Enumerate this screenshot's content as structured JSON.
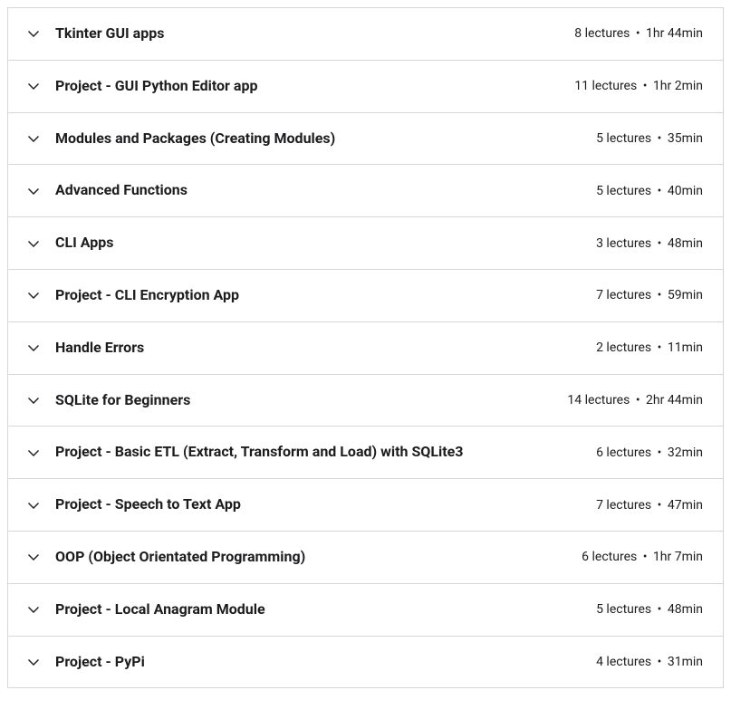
{
  "sections": [
    {
      "title": "Tkinter GUI apps",
      "lectures": "8 lectures",
      "duration": "1hr 44min"
    },
    {
      "title": "Project - GUI Python Editor app",
      "lectures": "11 lectures",
      "duration": "1hr 2min"
    },
    {
      "title": "Modules and Packages (Creating Modules)",
      "lectures": "5 lectures",
      "duration": "35min"
    },
    {
      "title": "Advanced Functions",
      "lectures": "5 lectures",
      "duration": "40min"
    },
    {
      "title": "CLI Apps",
      "lectures": "3 lectures",
      "duration": "48min"
    },
    {
      "title": "Project - CLI Encryption App",
      "lectures": "7 lectures",
      "duration": "59min"
    },
    {
      "title": "Handle Errors",
      "lectures": "2 lectures",
      "duration": "11min"
    },
    {
      "title": "SQLite for Beginners",
      "lectures": "14 lectures",
      "duration": "2hr 44min"
    },
    {
      "title": "Project - Basic ETL (Extract, Transform and Load) with SQLite3",
      "lectures": "6 lectures",
      "duration": "32min"
    },
    {
      "title": "Project - Speech to Text App",
      "lectures": "7 lectures",
      "duration": "47min"
    },
    {
      "title": "OOP (Object Orientated Programming)",
      "lectures": "6 lectures",
      "duration": "1hr 7min"
    },
    {
      "title": "Project - Local Anagram Module",
      "lectures": "5 lectures",
      "duration": "48min"
    },
    {
      "title": "Project - PyPi",
      "lectures": "4 lectures",
      "duration": "31min"
    }
  ],
  "meta_separator": "•"
}
